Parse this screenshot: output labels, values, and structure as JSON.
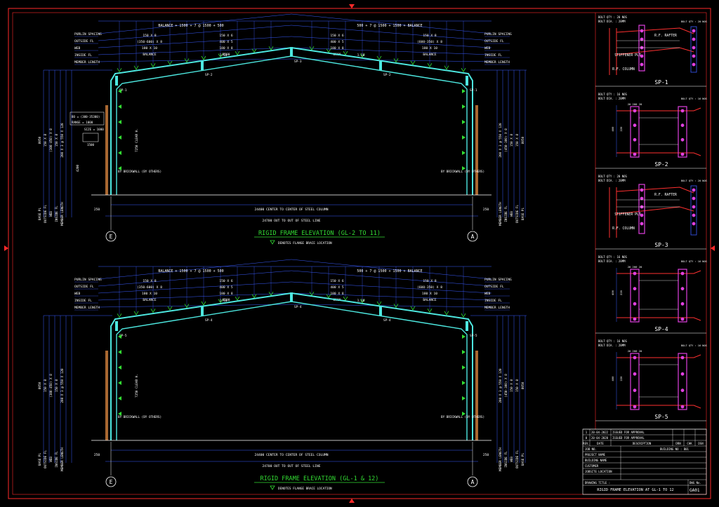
{
  "colors": {
    "background": "#000000",
    "border": "#ff2a2a",
    "frame": "#4de8e0",
    "dimension": "#3a5cff",
    "text": "#ffffff",
    "title": "#33dd33",
    "wall": "#c87a3a",
    "detail_red": "#ff3030",
    "detail_mag": "#e040e0",
    "green_mark": "#33dd33"
  },
  "frames": [
    {
      "title": "RIGID FRAME ELEVATION (GL-2 TO 11)",
      "note": "DENOTES FLANGE BRACE LOCATION",
      "top_dim_left": "BALANCE + 1500 + 7 @ 1500 + 500",
      "top_dim_right": "500 + 7 @ 1500 + 1500 + BALANCE",
      "left_labels": [
        "PURLIN SPACING",
        "OUTSIDE FL",
        "WEB",
        "INSIDE FL",
        "MEMBER LENGTH"
      ],
      "right_labels": [
        "PURLIN SPACING",
        "OUTSIDE FL",
        "WEB",
        "INSIDE FL",
        "MEMBER LENGTH"
      ],
      "rafter_left_sizes": [
        "150 X 8",
        "(350-600) X 8",
        "180 X 10",
        "BALANCE"
      ],
      "rafter_mid_left_sizes": [
        "150 X 6",
        "400 X 5",
        "180 X 8",
        "8500"
      ],
      "rafter_mid_right_sizes": [
        "150 X 6",
        "400 X 5",
        "180 X 8",
        "8500"
      ],
      "rafter_right_sizes": [
        "150 X 8",
        "(600-350) X 8",
        "180 X 10",
        "BALANCE"
      ],
      "splice_labels": [
        "SP-1",
        "SP-2",
        "SP-3",
        "SP-2",
        "SP-1"
      ],
      "slope_left": "1.10",
      "slope_right": "1.10",
      "apex_label": "SP-3",
      "wall_label_left": "BY BRICKWALL (BY OTHERS)",
      "wall_label_right": "BY BRICKWALL (BY OTHERS)",
      "col_height_label": "7250 CLEAR H.",
      "dim_center": "24400 CENTER TO CENTER OF STEEL COLUMN",
      "dim_out": "24700 OUT TO OUT OF STEEL LINE",
      "end_dim_left": "250",
      "end_dim_right": "250",
      "gridline_left": "E",
      "gridline_right": "A",
      "bottom_labels_left": [
        "BASE PL",
        "OUTSIDE FL",
        "WEB",
        "INSIDE FL",
        "MEMBER LENGTH"
      ],
      "bottom_labels_right": [
        "MEMBER LENGTH",
        "INSIDE FL",
        "WEB",
        "OUTSIDE FL",
        "BASE PL"
      ],
      "side_labels_left": [
        "8050",
        "150 X 8",
        "(300-450) X 8",
        "150 X 8",
        "200 X 3 @ 550 X 120"
      ],
      "side_labels_right": [
        "200 X 3 @ 550 X 120",
        "(450-300) X 8",
        "150 X 8",
        "150 X 8",
        "8050"
      ],
      "opening": [
        "BO = (300-35300)",
        "RANGE = 1000"
      ],
      "opening_size": "SIZE = 1000",
      "opening_dim": "1500",
      "opening_height": "4200"
    },
    {
      "title": "RIGID FRAME ELEVATION (GL-1 & 12)",
      "note": "DENOTES FLANGE BRACE LOCATION",
      "top_dim_left": "BALANCE + 1500 + 7 @ 1500 + 500",
      "top_dim_right": "500 + 7 @ 1500 + 1500 + BALANCE",
      "left_labels": [
        "PURLIN SPACING",
        "OUTSIDE FL",
        "WEB",
        "INSIDE FL",
        "MEMBER LENGTH"
      ],
      "right_labels": [
        "PURLIN SPACING",
        "OUTSIDE FL",
        "WEB",
        "INSIDE FL",
        "MEMBER LENGTH"
      ],
      "rafter_left_sizes": [
        "150 X 8",
        "(350-600) X 8",
        "180 X 10",
        "BALANCE"
      ],
      "rafter_mid_left_sizes": [
        "150 X 6",
        "400 X 5",
        "180 X 8",
        "8500"
      ],
      "rafter_mid_right_sizes": [
        "150 X 6",
        "400 X 5",
        "180 X 8",
        "8500"
      ],
      "rafter_right_sizes": [
        "150 X 8",
        "(600-350) X 8",
        "180 X 10",
        "BALANCE"
      ],
      "splice_labels": [
        "SP-5",
        "SP-4",
        "SP-4",
        "SP-4",
        "SP-5"
      ],
      "slope_left": "1.10",
      "slope_right": "1.10",
      "apex_label": "SP-4",
      "wall_label_left": "BY BRICKWALL (BY OTHERS)",
      "wall_label_right": "BY BRICKWALL (BY OTHERS)",
      "col_height_label": "7250 CLEAR H.",
      "dim_center": "24400 CENTER TO CENTER OF STEEL COLUMN",
      "dim_out": "24700 OUT TO OUT OF STEEL LINE",
      "end_dim_left": "250",
      "end_dim_right": "250",
      "gridline_left": "E",
      "gridline_right": "A",
      "bottom_labels_left": [
        "BASE PL",
        "OUTSIDE FL",
        "WEB",
        "INSIDE FL",
        "MEMBER LENGTH"
      ],
      "bottom_labels_right": [
        "MEMBER LENGTH",
        "INSIDE FL",
        "WEB",
        "OUTSIDE FL",
        "BASE PL"
      ],
      "side_labels_left": [
        "8050",
        "150 X 8",
        "(300-450) X 8",
        "150 X 8",
        "200 X 3 @ 550 X 120"
      ],
      "side_labels_right": [
        "200 X 3 @ 550 X 120",
        "(450-300) X 8",
        "150 X 8",
        "150 X 8",
        "8050"
      ]
    }
  ],
  "details": [
    {
      "label": "SP-1",
      "scale": "BOLT QTY : 20 NOS",
      "bolt": "BOLT DIA. : 20MM",
      "rafter": "R.F. RAFTER",
      "stiff": "STIFFENER PLT",
      "column": "R.F. COLUMN"
    },
    {
      "label": "SP-2",
      "scale": "BOLT QTY : 16 NOS",
      "bolt": "BOLT DIA. : 20MM",
      "dims": [
        "20 200 20",
        "400",
        "220"
      ]
    },
    {
      "label": "SP-3",
      "scale": "BOLT QTY : 20 NOS",
      "bolt": "BOLT DIA. : 20MM",
      "rafter": "R.F. RAFTER",
      "stiff": "STIFFENER PLT",
      "column": "R.F. COLUMN"
    },
    {
      "label": "SP-4",
      "scale": "BOLT QTY : 16 NOS",
      "bolt": "BOLT DIA. : 20MM",
      "dims": [
        "20 200 20",
        "400",
        "220"
      ]
    },
    {
      "label": "SP-5",
      "scale": "BOLT QTY : 16 NOS",
      "bolt": "BOLT DIA. : 20MM",
      "dims": [
        "20 200 20",
        "400",
        "220"
      ]
    }
  ],
  "title_block": {
    "revisions": [
      {
        "rev": "1",
        "date": "20-04-2022",
        "desc": "ISSUED FOR APPROVAL"
      },
      {
        "rev": "0",
        "date": "20-04-2020",
        "desc": "ISSUED FOR APPROVAL"
      }
    ],
    "headers": [
      "REV.",
      "DATE",
      "DESCRIPTION",
      "DRN",
      "CHK",
      "DSN"
    ],
    "fields": [
      {
        "label": "JOB NO.",
        "value": "",
        "extra": "BUILDING NO : B01"
      },
      {
        "label": "PROJECT NAME",
        "value": ""
      },
      {
        "label": "BUILDING NAME",
        "value": ""
      },
      {
        "label": "CUSTOMER",
        "value": ""
      },
      {
        "label": "JOBSITE LOCATION",
        "value": ""
      }
    ],
    "drawing_title_label": "DRAWING TITLE :",
    "drawing_title": "RIGID FRAME ELEVATION AT GL-1 TO 12",
    "dwg_no_label": "DWG No.",
    "dwg_no": "GA01"
  }
}
